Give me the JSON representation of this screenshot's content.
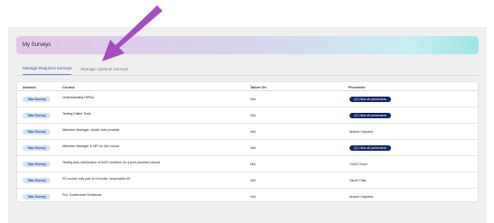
{
  "header": {
    "title": "My Surveys"
  },
  "tabs": [
    {
      "label": "Manage Required Surveys",
      "active": true
    },
    {
      "label": "Manage Optional Surveys",
      "active": false
    }
  ],
  "table": {
    "columns": [
      "Actions",
      "Course",
      "Taken On",
      "Presenter"
    ],
    "action_label": "Take Survey",
    "rows": [
      {
        "course": "Understanding HIPAA",
        "taken_on": "N/A",
        "presenter": "(3) View all presenters",
        "presenter_is_button": true
      },
      {
        "course": "Testing Failed Tests",
        "taken_on": "N/A",
        "presenter": "(2) View all presenters",
        "presenter_is_button": true
      },
      {
        "course": "Attendee Manager, virutal Joint provider",
        "taken_on": "N/A",
        "presenter": "Andoni Urquiaru",
        "presenter_is_button": false
      },
      {
        "course": "Attendee Manager & NPI for live course",
        "taken_on": "N/A",
        "presenter": "(2) View all presenters",
        "presenter_is_button": true
      },
      {
        "course": "Testing auto submission of AGD numbers for a joint provided course",
        "taken_on": "N/A",
        "presenter": "OnCE Zoom",
        "presenter_is_button": false
      },
      {
        "course": "SS course only part of a bundle, searchable AS",
        "taken_on": "N/A",
        "presenter": "Sarah Thiel",
        "presenter_is_button": false
      },
      {
        "course": "Pre- Conference Workbook",
        "taken_on": "N/A",
        "presenter": "Andoni Urquiaru",
        "presenter_is_button": false
      }
    ]
  },
  "colors": {
    "accent": "#14236b",
    "take_button_bg": "#d3e3f7",
    "active_tab": "#3a59c0",
    "annotation_arrow": "#a64dc4"
  },
  "icons": {
    "annotation": "arrow-pointer-icon"
  }
}
